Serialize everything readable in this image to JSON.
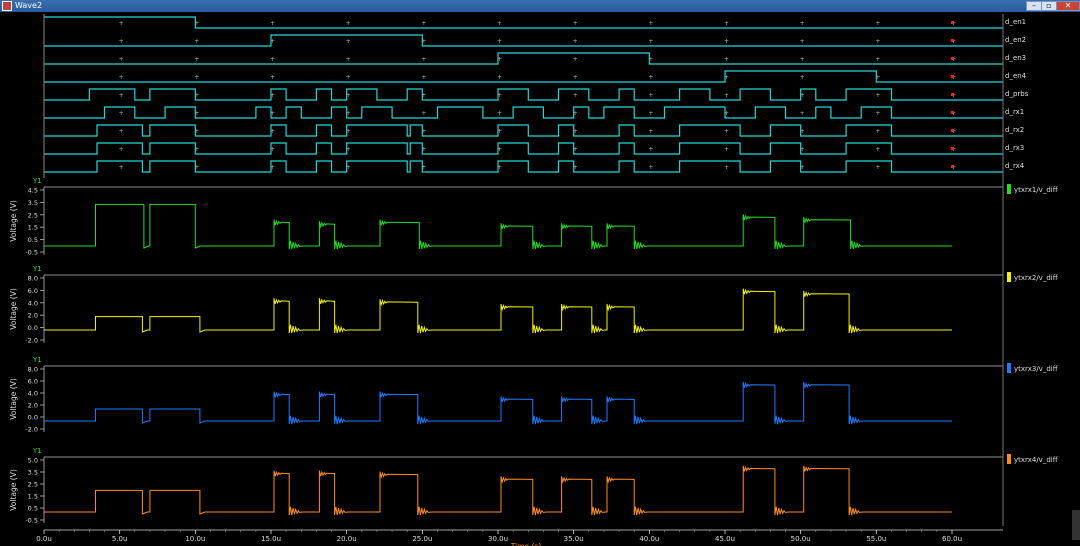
{
  "window": {
    "title": "Wave2",
    "buttons": {
      "minimize": "–",
      "maximize": "▫",
      "close": "✕"
    }
  },
  "digital": {
    "signals": [
      "d_en1",
      "d_en2",
      "d_en3",
      "d_en4",
      "d_prbs",
      "d_rx1",
      "d_rx2",
      "d_rx3",
      "d_rx4"
    ]
  },
  "colors": {
    "background": "#000000",
    "axis": "#c8c8c8",
    "digital": "#23d6d6",
    "analog": [
      "#22dd22",
      "#f0f000",
      "#1e7bff",
      "#ff8c1a"
    ],
    "cursor": "#ff2020"
  },
  "chart_data": [
    {
      "type": "line",
      "series": [
        {
          "name": "ytxrx1/v_diff",
          "color": "#22dd22"
        }
      ],
      "ylabel": "Voltage (V)",
      "axis_name": "Y1",
      "yticks": [
        "4.5",
        "3.5",
        "2.5",
        "1.5",
        "0.5",
        "-0.5"
      ],
      "ylim": [
        -0.5,
        4.5
      ]
    },
    {
      "type": "line",
      "series": [
        {
          "name": "ytxrx2/v_diff",
          "color": "#f0f000"
        }
      ],
      "ylabel": "Voltage (V)",
      "axis_name": "Y1",
      "yticks": [
        "8.0",
        "6.0",
        "4.0",
        "2.0",
        "0.0",
        "-2.0"
      ],
      "ylim": [
        -2.0,
        8.0
      ]
    },
    {
      "type": "line",
      "series": [
        {
          "name": "ytxrx3/v_diff",
          "color": "#1e7bff"
        }
      ],
      "ylabel": "Voltage (V)",
      "axis_name": "Y1",
      "yticks": [
        "8.0",
        "6.0",
        "4.0",
        "2.0",
        "0.0",
        "-2.0"
      ],
      "ylim": [
        -2.0,
        8.0
      ]
    },
    {
      "type": "line",
      "series": [
        {
          "name": "ytxrx4/v_diff",
          "color": "#ff8c1a"
        }
      ],
      "ylabel": "Voltage (V)",
      "axis_name": "Y1",
      "yticks": [
        "5.0",
        "3.5",
        "2.5",
        "1.5",
        "0.5",
        "-0.5"
      ],
      "ylim": [
        -0.5,
        5.0
      ]
    }
  ],
  "x_axis": {
    "label": "Time (s)",
    "ticks": [
      "0.0u",
      "5.0u",
      "10.0u",
      "15.0u",
      "20.0u",
      "25.0u",
      "30.0u",
      "35.0u",
      "40.0u",
      "45.0u",
      "50.0u",
      "55.0u",
      "60.0u"
    ],
    "range_us": [
      0,
      60
    ]
  }
}
